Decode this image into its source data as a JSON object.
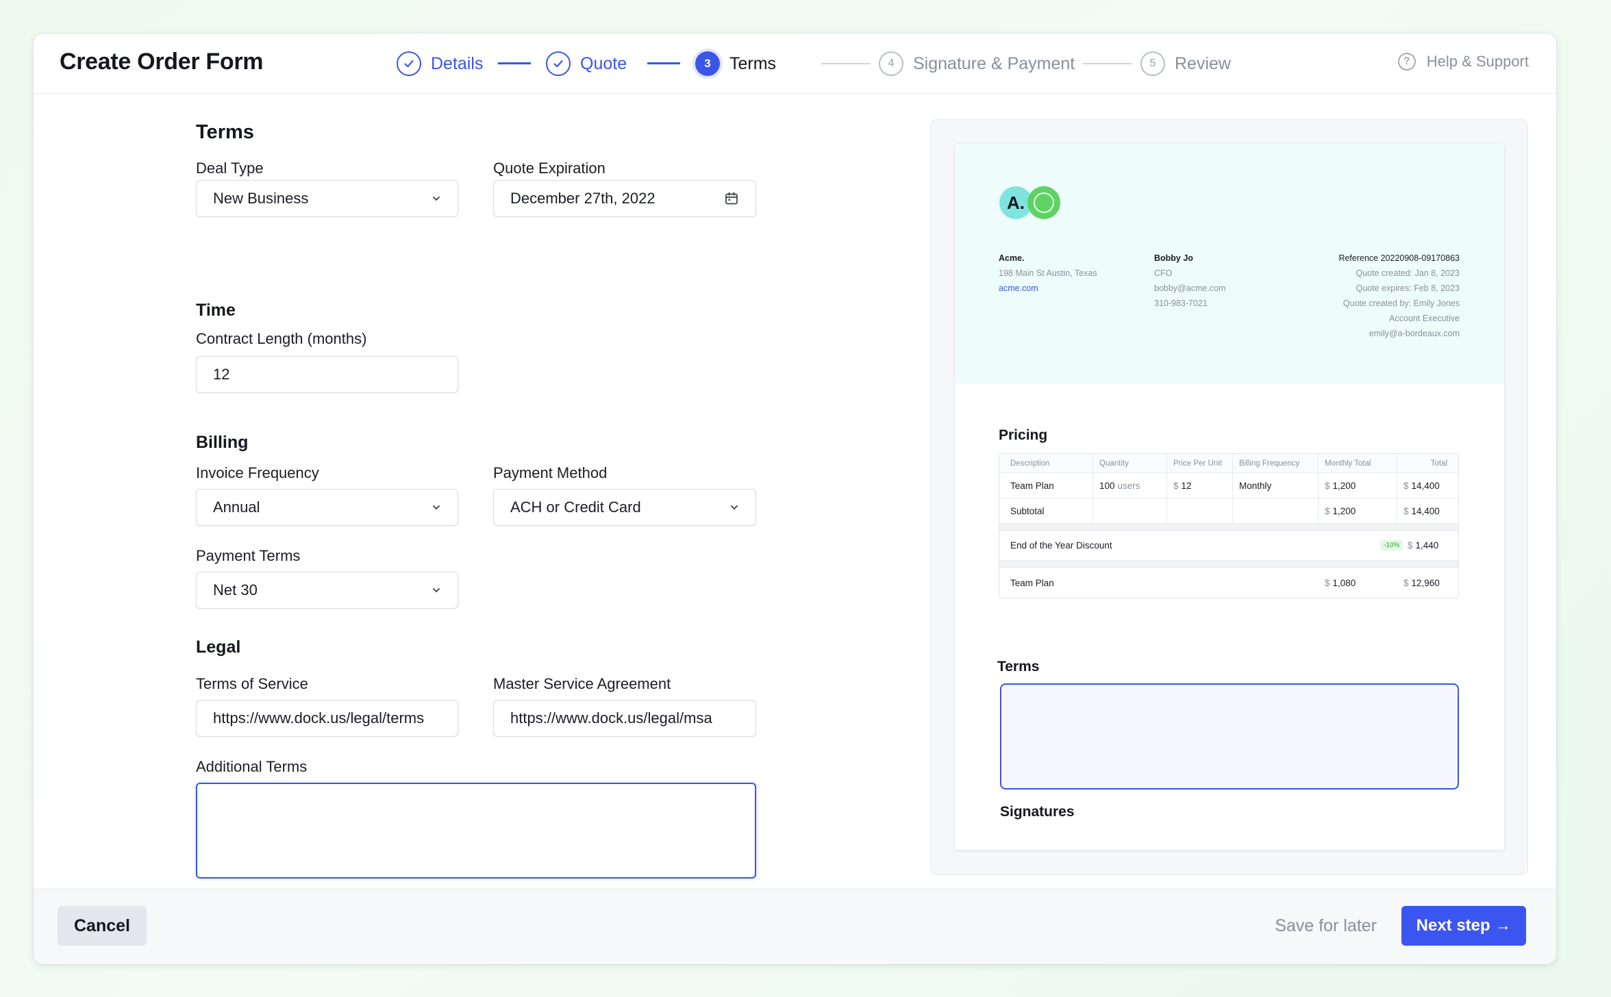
{
  "header": {
    "title": "Create Order Form",
    "help_label": "Help & Support",
    "steps": [
      {
        "label": "Details",
        "state": "done",
        "number": "1"
      },
      {
        "label": "Quote",
        "state": "done",
        "number": "2"
      },
      {
        "label": "Terms",
        "state": "active",
        "number": "3"
      },
      {
        "label": "Signature & Payment",
        "state": "todo",
        "number": "4"
      },
      {
        "label": "Review",
        "state": "todo",
        "number": "5"
      }
    ]
  },
  "form": {
    "terms": {
      "title": "Terms",
      "deal_type_label": "Deal Type",
      "deal_type_value": "New Business",
      "quote_expiration_label": "Quote Expiration",
      "quote_expiration_value": "December 27th, 2022"
    },
    "time": {
      "title": "Time",
      "contract_length_label": "Contract Length (months)",
      "contract_length_value": "12"
    },
    "billing": {
      "title": "Billing",
      "invoice_frequency_label": "Invoice Frequency",
      "invoice_frequency_value": "Annual",
      "payment_method_label": "Payment Method",
      "payment_method_value": "ACH or Credit Card",
      "payment_terms_label": "Payment Terms",
      "payment_terms_value": "Net 30"
    },
    "legal": {
      "title": "Legal",
      "tos_label": "Terms of Service",
      "tos_value": "https://www.dock.us/legal/terms",
      "msa_label": "Master Service Agreement",
      "msa_value": "https://www.dock.us/legal/msa",
      "additional_terms_label": "Additional Terms",
      "additional_terms_value": ""
    }
  },
  "footer": {
    "cancel_label": "Cancel",
    "save_label": "Save for later",
    "next_label": "Next step →"
  },
  "preview": {
    "logo_letter": "A.",
    "company": {
      "name": "Acme.",
      "address": "198 Main St Austin, Texas",
      "website": "acme.com"
    },
    "contact": {
      "name": "Bobby Jo",
      "role": "CFO",
      "email": "bobby@acme.com",
      "phone": "310-983-7021"
    },
    "quote_meta": {
      "reference": "Reference 20220908-09170863",
      "created": "Quote created: Jan 8, 2023",
      "expires": "Quote expires: Feb 8, 2023",
      "created_by": "Quote created by: Emily Jones",
      "role": "Account Executive",
      "email": "emily@a-bordeaux.com"
    },
    "pricing_title": "Pricing",
    "pricing_table": {
      "columns": [
        "Description",
        "Quantity",
        "Price Per Unit",
        "Billing Frequency",
        "Monthly Total",
        "Total"
      ],
      "row": {
        "description": "Team Plan",
        "quantity": "100",
        "quantity_unit": "users",
        "currency": "$",
        "price": "12",
        "frequency": "Monthly",
        "monthly_total": "1,200",
        "total": "14,400"
      },
      "subtotal": {
        "label": "Subtotal",
        "monthly_total": "1,200",
        "total": "14,400"
      },
      "discount": {
        "label": "End of the Year Discount",
        "badge": "-10%",
        "total": "1,440"
      },
      "final": {
        "label": "Team Plan",
        "monthly_total": "1,080",
        "total": "12,960"
      }
    },
    "terms_title": "Terms",
    "signatures_title": "Signatures"
  },
  "colors": {
    "accent": "#3b55e6",
    "button": "#3b55f0",
    "preview_header_bg": "#eefcfc"
  }
}
